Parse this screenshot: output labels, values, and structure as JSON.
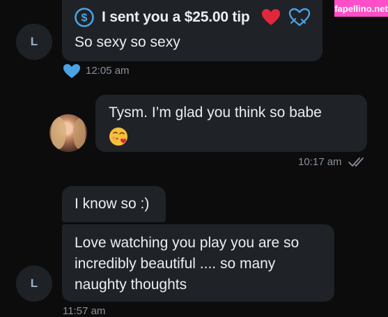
{
  "watermark": "fapellino.net",
  "messages": {
    "tip": {
      "avatar_initial": "L",
      "tip_text": "I sent you a $25.00 tip",
      "body": "So sexy so sexy",
      "time": "12:05 am"
    },
    "reply": {
      "text": "Tysm. I’m glad you think so babe",
      "time": "10:17 am"
    },
    "short": {
      "text": "I know so :)"
    },
    "long": {
      "avatar_initial": "L",
      "lines": [
        "Love watching you play you are so",
        "incredibly beautiful .... so many",
        "naughty thoughts"
      ],
      "time": "11:57 am"
    }
  },
  "colors": {
    "bubble": "#1f2227",
    "background": "#0c0c0d",
    "accent_blue": "#4aa3e3",
    "heart_red": "#e0283a"
  },
  "icons": [
    "dollar-icon",
    "heart-icon",
    "heart-outline-icon",
    "like-heart-icon",
    "double-check-icon",
    "kiss-emoji-icon"
  ]
}
